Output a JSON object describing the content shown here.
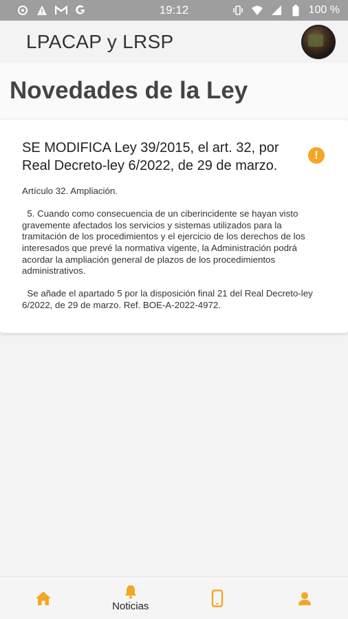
{
  "status_bar": {
    "time": "19:12",
    "battery": "100 %",
    "left_icons": [
      "settings-icon",
      "warning-icon",
      "gmail-icon",
      "google-icon"
    ],
    "right_icons": [
      "vibrate-icon",
      "wifi-icon",
      "signal-icon",
      "battery-icon"
    ]
  },
  "app_bar": {
    "title": "LPACAP y LRSP"
  },
  "page": {
    "title": "Novedades de la Ley"
  },
  "news": [
    {
      "title": "SE MODIFICA Ley 39/2015, el art. 32, por Real Decreto-ley 6/2022, de 29 de marzo.",
      "alert_symbol": "!",
      "alert_color": "#f5a623",
      "paragraphs": [
        "Artículo 32. Ampliación.",
        "  5. Cuando como consecuencia de un ciberincidente se hayan visto gravemente afectados los servicios y sistemas utilizados para la tramitación de los procedimientos y el ejercicio de los derechos de los interesados que prevé la normativa vigente, la Administración podrá acordar la ampliación general de plazos de los procedimientos administrativos.",
        "  Se añade el apartado 5 por la disposición final 21 del Real Decreto-ley 6/2022, de 29 de marzo. Ref. BOE-A-2022-4972."
      ]
    }
  ],
  "bottom_nav": {
    "accent": "#f5a623",
    "items": [
      {
        "icon": "home-icon",
        "label": ""
      },
      {
        "icon": "bell-icon",
        "label": "Noticias"
      },
      {
        "icon": "phone-icon",
        "label": ""
      },
      {
        "icon": "user-icon",
        "label": ""
      }
    ]
  }
}
